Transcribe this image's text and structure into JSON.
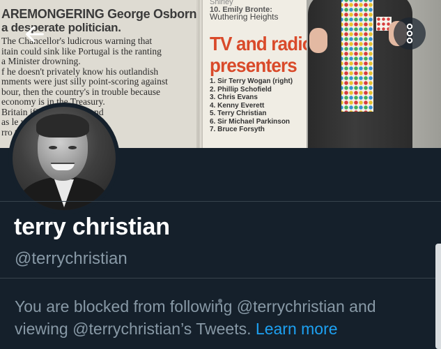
{
  "header": {
    "back_icon": "arrow-left-icon",
    "more_icon": "more-vertical-icon",
    "banner": {
      "left_headline": "AREMONGERING George Osborne",
      "left_subhead": "a desperate politician.",
      "left_lines": [
        "The Chancellor's ludicrous warning that",
        "itain could sink like Portugal is the ranting",
        "a Minister drowning.",
        "f he doesn't privately know his outlandish",
        "mments were just silly point-scoring against",
        "bour, then the country's in trouble because",
        "economy is in the Treasury.",
        "Britain  ificantly bigger and",
        "as le  which must repay",
        "rro      the Chancel-"
      ],
      "right_ref_top": "Shirley",
      "right_ref": "10. Emily Bronte:",
      "right_ref_sub": "Wuthering Heights",
      "right_title_1": "TV and radio",
      "right_title_2": "presenters",
      "right_list": [
        "1. Sir Terry Wogan (right)",
        "2. Phillip Schofield",
        "3. Chris Evans",
        "4. Kenny Everett",
        "5. Terry Christian",
        "6. Sir Michael Parkinson",
        "7. Bruce Forsyth"
      ]
    }
  },
  "profile": {
    "display_name": "terry christian",
    "handle": "@terrychristian",
    "blocked_message": "You are blocked from following @terrychristian and viewing @terrychristian’s Tweets.",
    "learn_more_label": "Learn more"
  },
  "colors": {
    "background": "#15202b",
    "divider": "#38444d",
    "secondary_text": "#8899a6",
    "link": "#1da1f2",
    "primary_text": "#ffffff"
  }
}
